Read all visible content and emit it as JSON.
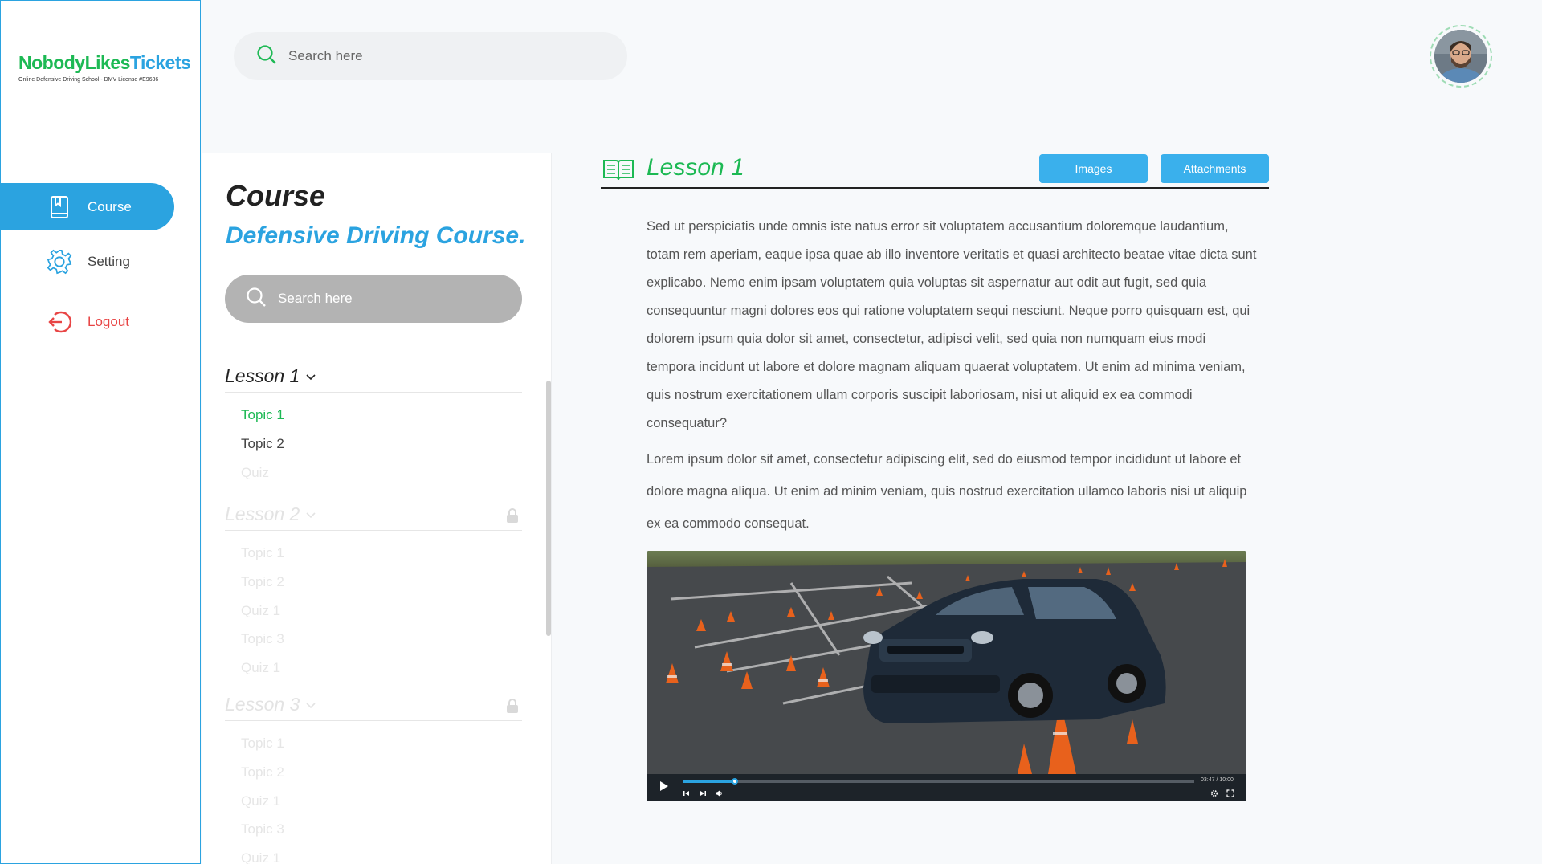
{
  "brand": {
    "name_part1": "NobodyLikes",
    "name_part2": "Tickets",
    "tagline": "Online Defensive Driving School - DMV License #E9636",
    "color_primary": "#1db954",
    "color_secondary": "#2ba3e0"
  },
  "sidebar": {
    "items": [
      {
        "label": "Course",
        "icon": "bookmark-book-icon",
        "active": true
      },
      {
        "label": "Setting",
        "icon": "gear-icon",
        "active": false
      },
      {
        "label": "Logout",
        "icon": "logout-icon",
        "active": false
      }
    ]
  },
  "header": {
    "search_placeholder": "Search here",
    "avatar": "user-avatar"
  },
  "course_panel": {
    "title": "Course",
    "subtitle": "Defensive Driving Course.",
    "search_placeholder": "Search here",
    "lessons": [
      {
        "title": "Lesson 1",
        "locked": false,
        "items": [
          "Topic 1",
          "Topic 2",
          "Quiz"
        ]
      },
      {
        "title": "Lesson 2",
        "locked": true,
        "items": [
          "Topic 1",
          "Topic 2",
          "Quiz 1",
          "Topic 3",
          "Quiz 1"
        ]
      },
      {
        "title": "Lesson 3",
        "locked": true,
        "items": [
          "Topic 1",
          "Topic 2",
          "Quiz 1",
          "Topic 3",
          "Quiz 1"
        ]
      }
    ]
  },
  "content": {
    "lesson_title": "Lesson 1",
    "images_button": "Images",
    "attachments_button": "Attachments",
    "paragraph1": "Sed ut perspiciatis unde omnis iste natus error sit voluptatem accusantium doloremque laudantium, totam rem aperiam, eaque ipsa quae ab illo inventore veritatis et quasi architecto beatae vitae dicta sunt explicabo. Nemo enim ipsam voluptatem quia voluptas sit aspernatur aut odit aut fugit, sed quia consequuntur magni dolores eos qui ratione voluptatem sequi nesciunt. Neque porro quisquam est, qui dolorem ipsum quia dolor sit amet, consectetur, adipisci velit, sed quia non numquam eius modi tempora incidunt ut labore et dolore magnam aliquam quaerat voluptatem. Ut enim ad minima veniam, quis nostrum exercitationem ullam corporis suscipit laboriosam, nisi ut aliquid ex ea commodi consequatur?",
    "paragraph2": "Lorem ipsum dolor sit amet, consectetur adipiscing elit, sed do eiusmod tempor incididunt ut labore et dolore magna aliqua. Ut enim ad minim veniam, quis nostrud exercitation ullamco laboris nisi ut aliquip ex ea commodo consequat."
  },
  "video": {
    "time_display": "03:47 / 10:00",
    "progress_fraction": 0.1
  }
}
